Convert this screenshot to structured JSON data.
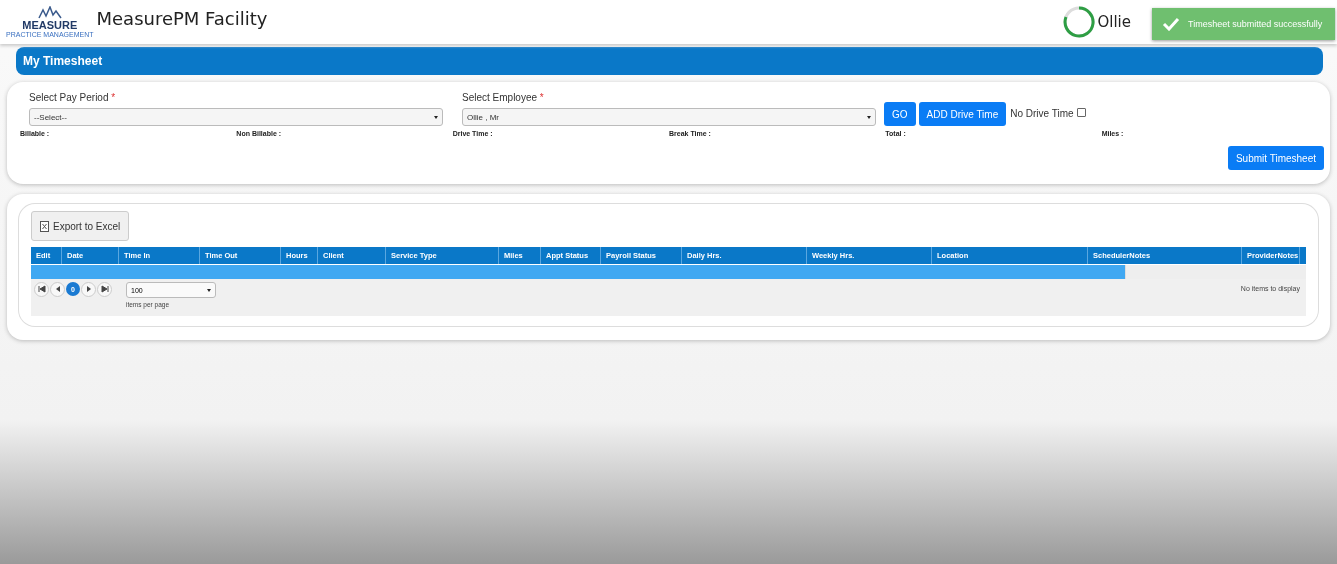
{
  "header": {
    "logo_text": "MEASURE",
    "logo_sub": "PRACTICE MANAGEMENT",
    "title": "MeasurePM Facility",
    "user": "Ollie"
  },
  "toast": {
    "message": "Timesheet submitted successfully"
  },
  "panel_title": "My Timesheet",
  "form": {
    "pay_period": {
      "label": "Select Pay Period",
      "required_mark": "*",
      "value": "--Select--"
    },
    "employee": {
      "label": "Select Employee",
      "required_mark": "*",
      "value": "Ollie , Mr"
    },
    "go_button": "GO",
    "add_drive_button": "ADD Drive Time",
    "no_drive_time": {
      "label": "No Drive Time",
      "checked": false
    },
    "totals": [
      "Billable :",
      "Non Billable :",
      "Drive Time :",
      "Break Time :",
      "Total :",
      "Miles :"
    ],
    "submit_button": "Submit Timesheet"
  },
  "grid": {
    "export_button": "Export to Excel",
    "columns": [
      {
        "label": "Edit"
      },
      {
        "label": "Date"
      },
      {
        "label": "Time In"
      },
      {
        "label": "Time Out"
      },
      {
        "label": "Hours"
      },
      {
        "label": "Client"
      },
      {
        "label": "Service Type"
      },
      {
        "label": "Miles"
      },
      {
        "label": "Appt Status"
      },
      {
        "label": "Payroll Status"
      },
      {
        "label": "Daily Hrs."
      },
      {
        "label": "Weekly Hrs."
      },
      {
        "label": "Location"
      },
      {
        "label": "SchedulerNotes"
      },
      {
        "label": "ProviderNotes"
      }
    ],
    "pager": {
      "page": "0",
      "page_size": "100",
      "page_size_label": "items per page",
      "status": "No items to display"
    }
  }
}
